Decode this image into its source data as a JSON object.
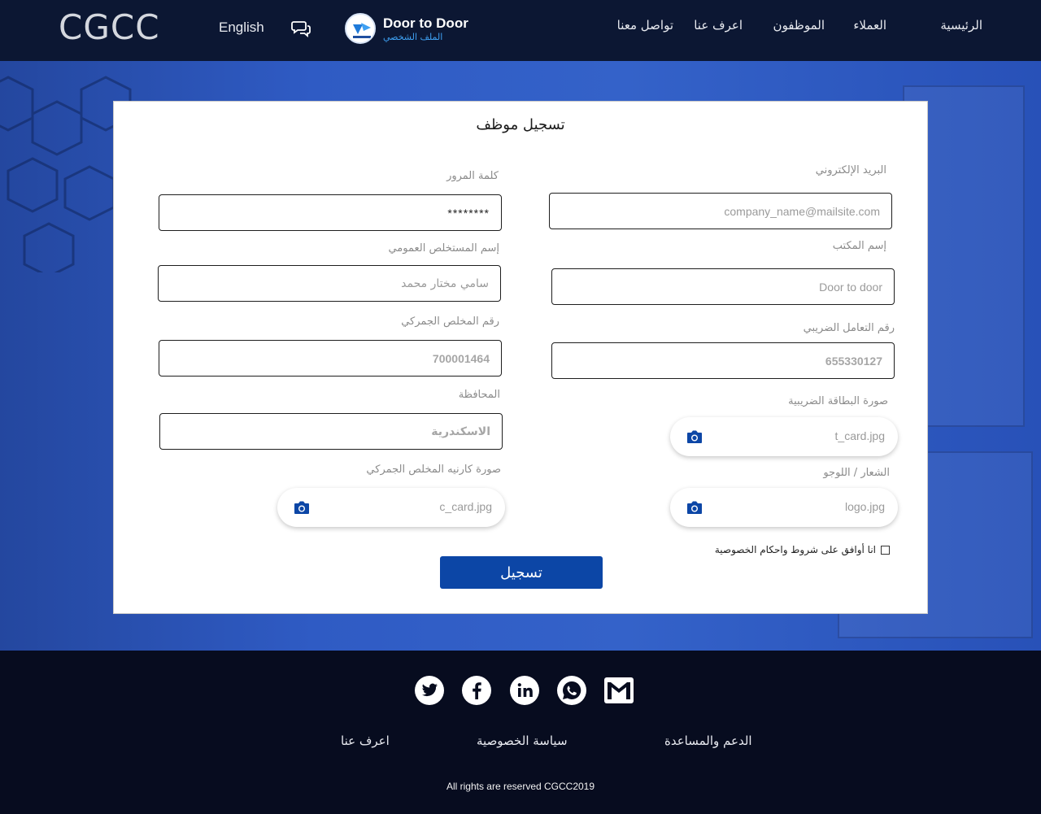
{
  "header": {
    "logo": "CGCC",
    "language": "English",
    "profile": {
      "name": "Door to Door",
      "subtitle": "الملف الشخصي"
    },
    "nav": [
      "الرئيسية",
      "العملاء",
      "الموظفون",
      "اعرف عنا",
      "تواصل معنا"
    ]
  },
  "form": {
    "title": "تسجيل موظف",
    "email_label": "البريد الإلكتروني",
    "email_placeholder": "company_name@mailsite.com",
    "password_label": "كلمة المرور",
    "password_value": "********",
    "office_label": "إسم المكتب",
    "office_value": "Door to door",
    "clearer_name_label": "إسم المستخلص العمومي",
    "clearer_name_value": "سامي مختار محمد",
    "tax_label": "رقم التعامل الضريبي",
    "tax_value": "655330127",
    "customs_label": "رقم المخلص الجمركي",
    "customs_value": "700001464",
    "governorate_label": "المحافظة",
    "governorate_value": "الاسكندرية",
    "tax_card_label": "صورة البطاقة الضريبية",
    "tax_card_file": "t_card.jpg",
    "logo_label": "الشعار / اللوجو",
    "logo_file": "logo.jpg",
    "customs_card_label": "صورة كارنيه المخلص الجمركي",
    "customs_card_file": "c_card.jpg",
    "agree_text": "انا أوافق على شروط واحكام الخصوصية",
    "submit_label": "تسجيل"
  },
  "footer": {
    "links": [
      "الدعم والمساعدة",
      "سياسة الخصوصية",
      "اعرف عنا"
    ],
    "social": [
      "gmail-icon",
      "whatsapp-icon",
      "linkedin-icon",
      "facebook-icon",
      "twitter-icon"
    ],
    "copyright": "All rights are reserved CGCC2019"
  },
  "colors": {
    "header_bg": "#0c1733",
    "footer_bg": "#070c1f",
    "hero_bg": "#2f5bc4",
    "accent": "#0c46a6",
    "profile_sub": "#3ea0f2"
  }
}
